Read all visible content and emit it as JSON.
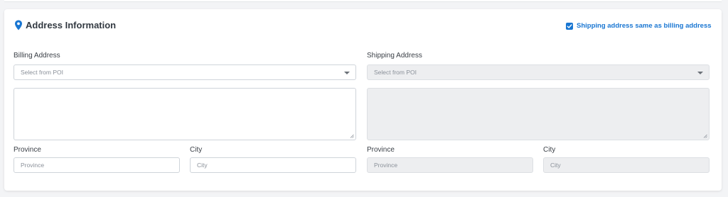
{
  "header": {
    "title": "Address Information",
    "icon": "map-pin-icon",
    "accent": "#1976d2"
  },
  "same_as_billing": {
    "label": "Shipping address same as billing address",
    "checked": true
  },
  "billing": {
    "label": "Billing Address",
    "poi_placeholder": "Select from POI",
    "province_label": "Province",
    "province_placeholder": "Province",
    "city_label": "City",
    "city_placeholder": "City"
  },
  "shipping": {
    "label": "Shipping Address",
    "poi_placeholder": "Select from POI",
    "province_label": "Province",
    "province_placeholder": "Province",
    "city_label": "City",
    "city_placeholder": "City",
    "disabled": true
  }
}
